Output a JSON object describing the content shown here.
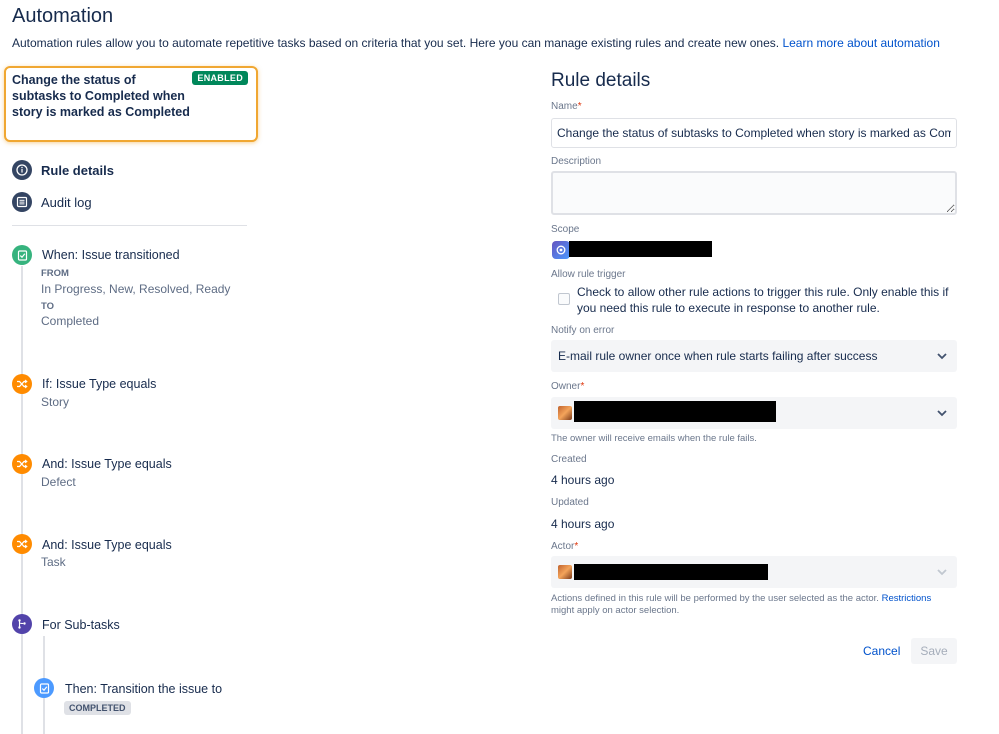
{
  "page": {
    "title": "Automation",
    "description": "Automation rules allow you to automate repetitive tasks based on criteria that you set. Here you can manage existing rules and create new ones.",
    "learn_more": "Learn more about automation"
  },
  "rule_card": {
    "title": "Change the status of subtasks to Completed when story is marked as Completed",
    "status": "ENABLED"
  },
  "nav": {
    "rule_details": "Rule details",
    "audit_log": "Audit log"
  },
  "steps": {
    "trigger": {
      "title": "When: Issue transitioned",
      "from_label": "FROM",
      "from_value": "In Progress, New, Resolved, Ready",
      "to_label": "TO",
      "to_value": "Completed"
    },
    "cond1": {
      "title": "If: Issue Type equals",
      "value": "Story"
    },
    "cond2": {
      "title": "And: Issue Type equals",
      "value": "Defect"
    },
    "cond3": {
      "title": "And: Issue Type equals",
      "value": "Task"
    },
    "branch": {
      "title": "For Sub-tasks"
    },
    "action": {
      "title": "Then: Transition the issue to",
      "lozenge": "COMPLETED"
    }
  },
  "details": {
    "heading": "Rule details",
    "name_label": "Name",
    "name_value": "Change the status of subtasks to Completed when story is marked as Completed",
    "description_label": "Description",
    "description_value": "",
    "scope_label": "Scope",
    "allow_trigger_label": "Allow rule trigger",
    "allow_trigger_text": "Check to allow other rule actions to trigger this rule. Only enable this if you need this rule to execute in response to another rule.",
    "notify_label": "Notify on error",
    "notify_value": "E-mail rule owner once when rule starts failing after success",
    "owner_label": "Owner",
    "owner_helper": "The owner will receive emails when the rule fails.",
    "created_label": "Created",
    "created_value": "4 hours ago",
    "updated_label": "Updated",
    "updated_value": "4 hours ago",
    "actor_label": "Actor",
    "actor_helper": "Actions defined in this rule will be performed by the user selected as the actor.",
    "actor_helper_link": "Restrictions",
    "actor_helper_tail": "might apply on actor selection.",
    "required_mark": "*",
    "cancel": "Cancel",
    "save": "Save"
  },
  "colors": {
    "accent": "#0052cc",
    "enabled": "#00875a",
    "card_highlight": "#f0a732",
    "trigger_green": "#36b37e",
    "condition_orange": "#ff8b00",
    "branch_purple": "#5243aa",
    "action_blue": "#4c9aff"
  }
}
